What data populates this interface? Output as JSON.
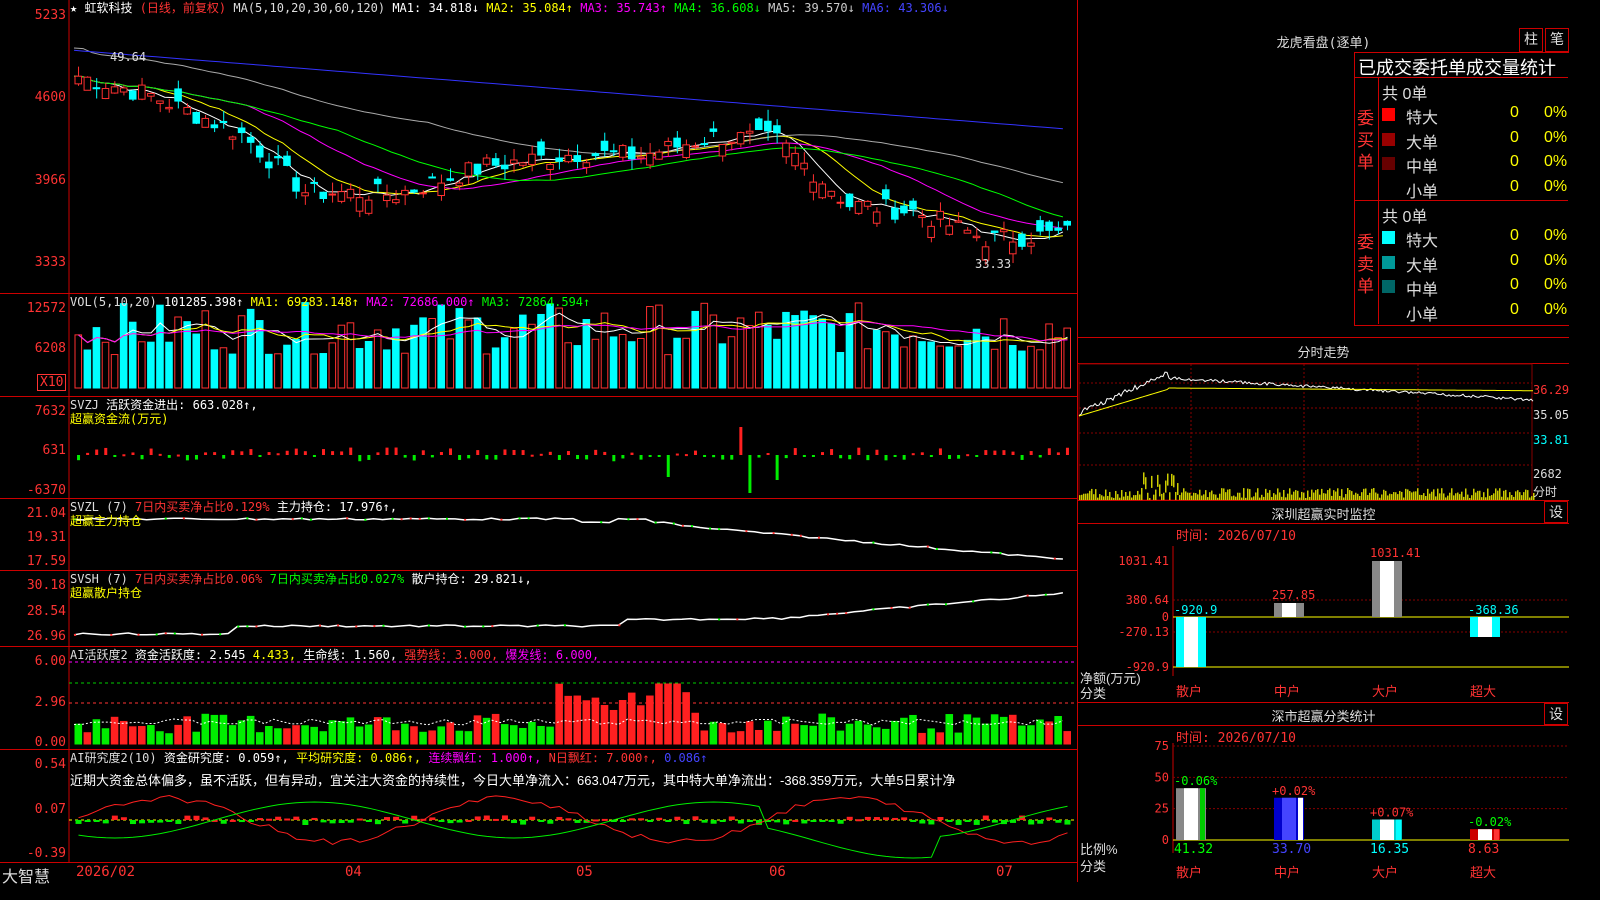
{
  "kline": {
    "title": "★ 虹软科技",
    "period": "(日线，前复权)",
    "ma_label": "MA(5,10,20,30,60,120)",
    "ma": [
      {
        "name": "MA1:",
        "value": "34.818↓",
        "color": "#ffffff"
      },
      {
        "name": "MA2:",
        "value": "35.084↑",
        "color": "#ffff00"
      },
      {
        "name": "MA3:",
        "value": "35.743↑",
        "color": "#ff00ff"
      },
      {
        "name": "MA4:",
        "value": "36.608↓",
        "color": "#00ff00"
      },
      {
        "name": "MA5:",
        "value": "39.570↓",
        "color": "#c0c0c0"
      },
      {
        "name": "MA6:",
        "value": "43.306↓",
        "color": "#3030ff"
      }
    ],
    "y_ticks": [
      "5233",
      "4600",
      "3966",
      "3333"
    ],
    "high_label": "49.64",
    "low_label": "33.33"
  },
  "vol": {
    "label": "VOL(5,10,20)",
    "value": "101285.398↑",
    "ma1": "MA1: 69283.148↑",
    "ma2": "MA2: 72686.000↑",
    "ma3": "MA3: 72864.594↑",
    "y_ticks": [
      "12572",
      "6208"
    ],
    "unit": "X10"
  },
  "svzj": {
    "label": "SVZJ",
    "line1": "活跃资金进出: 663.028↑,",
    "line2": "超赢资金流(万元)",
    "y_ticks": [
      "7632",
      "631",
      "-6370"
    ]
  },
  "svzl": {
    "label": "SVZL (7)",
    "pct": "7日内买卖净占比0.129%",
    "hold": "主力持仓: 17.976↑,",
    "line2": "超赢主力持仓",
    "y_ticks": [
      "21.04",
      "19.31",
      "17.59"
    ]
  },
  "svsh": {
    "label": "SVSH (7)",
    "pct1": "7日内买卖净占比0.06%",
    "pct2": "7日内买卖净占比0.027%",
    "hold": "散户持仓: 29.821↓,",
    "line2": "超赢散户持仓",
    "y_ticks": [
      "30.18",
      "28.54",
      "26.96"
    ]
  },
  "ai1": {
    "label": "AI活跃度2",
    "act": "资金活跃度: 2.545",
    "v2": "4.433,",
    "life": "生命线: 1.560,",
    "strong": "强势线: 3.000,",
    "burst": "爆发线: 6.000,",
    "y_ticks": [
      "6.00",
      "2.96",
      "0.00"
    ]
  },
  "ai2": {
    "label": "AI研究度2(10)",
    "research": "资金研究度: 0.059↑,",
    "avg": "平均研究度: 0.086↑,",
    "cont": "连续飘红: 1.000↑,",
    "nday": "N日飘红: 7.000↑,",
    "extra": "0.086↑",
    "comment": "近期大资金总体偏多，虽不活跃，但有异动，宜关注大资金的持续性，今日大单净流入：663.047万元，其中特大单净流出：-368.359万元，大单5日累计净",
    "y_ticks": [
      "0.54",
      "0.07",
      "-0.39"
    ]
  },
  "xaxis": {
    "brand": "大智慧",
    "labels": [
      "2026/02",
      "04",
      "05",
      "06",
      "07"
    ]
  },
  "right": {
    "lhb_title": "龙虎看盘(逐单)",
    "btn_zhu": "柱",
    "btn_bi": "笔",
    "stats_title": "已成交委托单成交量统计",
    "buy_label": "委买单",
    "sell_label": "委卖单",
    "buy_total": "共 0单",
    "sell_total": "共 0单",
    "buy_rows": [
      {
        "name": "特大",
        "count": "0",
        "pct": "0%",
        "color": "#ff0000"
      },
      {
        "name": "大单",
        "count": "0",
        "pct": "0%",
        "color": "#990000"
      },
      {
        "name": "中单",
        "count": "0",
        "pct": "0%",
        "color": "#660000"
      },
      {
        "name": "小单",
        "count": "0",
        "pct": "0%",
        "color": "#000000"
      }
    ],
    "sell_rows": [
      {
        "name": "特大",
        "count": "0",
        "pct": "0%",
        "color": "#00ffff"
      },
      {
        "name": "大单",
        "count": "0",
        "pct": "0%",
        "color": "#009999"
      },
      {
        "name": "中单",
        "count": "0",
        "pct": "0%",
        "color": "#006666"
      },
      {
        "name": "小单",
        "count": "0",
        "pct": "0%",
        "color": "#000000"
      }
    ],
    "minute_title": "分时走势",
    "minute_ticks": [
      "36.29",
      "35.05",
      "33.81",
      "2682",
      "分时"
    ],
    "sz_title": "深圳超赢实时监控",
    "sz_btn": "设",
    "sz_time": "时间: 2026/07/10",
    "sz_ticks": [
      "1031.41",
      "380.64",
      "0",
      "-270.13",
      "-920.9"
    ],
    "sz_values": [
      {
        "cat": "散户",
        "value": "-920.9"
      },
      {
        "cat": "中户",
        "value": "257.85"
      },
      {
        "cat": "大户",
        "value": "1031.41"
      },
      {
        "cat": "超大",
        "value": "-368.36"
      }
    ],
    "sz_ylabel": "净额(万元)",
    "sz_xlabel": "分类",
    "sc_title": "深市超赢分类统计",
    "sc_btn": "设",
    "sc_time": "时间: 2026/07/10",
    "sc_ticks": [
      "75",
      "50",
      "25",
      "0"
    ],
    "sc_values": [
      {
        "cat": "散户",
        "value": "41.32",
        "chg": "-0.06%",
        "chg_color": "#00ff00"
      },
      {
        "cat": "中户",
        "value": "33.70",
        "chg": "+0.02%",
        "chg_color": "#ff3333"
      },
      {
        "cat": "大户",
        "value": "16.35",
        "chg": "+0.07%",
        "chg_color": "#ff3333"
      },
      {
        "cat": "超大",
        "value": "8.63",
        "chg": "-0.02%",
        "chg_color": "#00ff00"
      }
    ],
    "sc_ylabel": "比例%",
    "sc_xlabel": "分类"
  }
}
